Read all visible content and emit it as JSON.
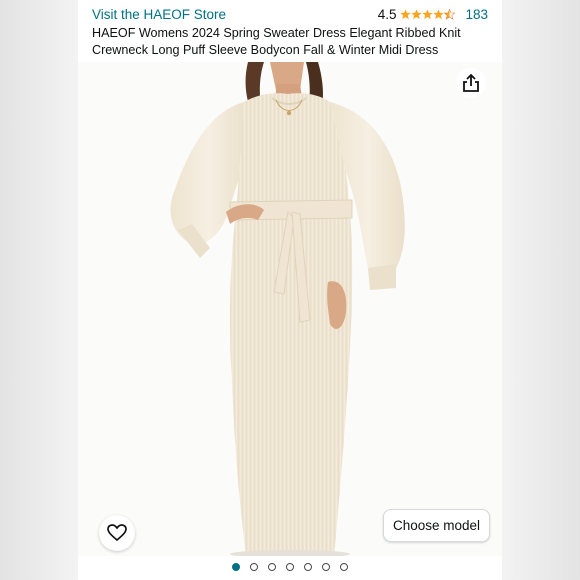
{
  "header": {
    "store_link": "Visit the HAEOF Store",
    "rating": "4.5",
    "stars": {
      "filled": 4,
      "half": 1,
      "out_of": 5
    },
    "review_count": "183",
    "star_color": "#ffa41c"
  },
  "product": {
    "title": "HAEOF Womens 2024 Spring Sweater Dress Elegant Ribbed Knit Crewneck Long Puff Sleeve Bodycon Fall & Winter Midi Dress"
  },
  "actions": {
    "share_icon": "share-icon",
    "wishlist_icon": "heart-icon",
    "choose_model_label": "Choose model"
  },
  "gallery": {
    "image_count": 7,
    "active_index": 0
  },
  "colors": {
    "link": "#007185",
    "dress": "#f2ead9",
    "text": "#0f1111"
  }
}
